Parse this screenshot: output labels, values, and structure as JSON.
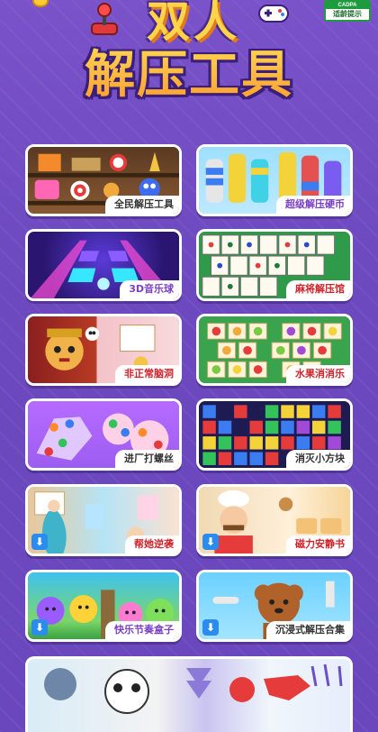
{
  "header": {
    "title_top": "双人",
    "title_main": "解压工具",
    "age_badge": {
      "brand": "CADPA",
      "text": "适龄提示"
    }
  },
  "cards": [
    {
      "label": "全民解压工具",
      "icon": "toy-shelf-art"
    },
    {
      "label": "超级解压硬币",
      "icon": "coin-stacks-art"
    },
    {
      "label": "3D音乐球",
      "icon": "music-tiles-art"
    },
    {
      "label": "麻将解压馆",
      "icon": "mahjong-art"
    },
    {
      "label": "非正常脑洞",
      "icon": "monkey-king-art"
    },
    {
      "label": "水果消消乐",
      "icon": "fruit-match-art"
    },
    {
      "label": "进厂打螺丝",
      "icon": "screws-art"
    },
    {
      "label": "消灭小方块",
      "icon": "block-pop-art"
    },
    {
      "label": "帮她逆袭",
      "icon": "dress-up-art",
      "download": true
    },
    {
      "label": "磁力安静书",
      "icon": "chef-art",
      "download": true
    },
    {
      "label": "快乐节奏盒子",
      "icon": "rhythm-box-art",
      "download": true
    },
    {
      "label": "沉浸式解压合集",
      "icon": "dog-grooming-art",
      "download": true
    }
  ],
  "colors": {
    "background": "#6c49bf",
    "card_border": "#ffffff",
    "download_button": "#2a8cf0"
  }
}
